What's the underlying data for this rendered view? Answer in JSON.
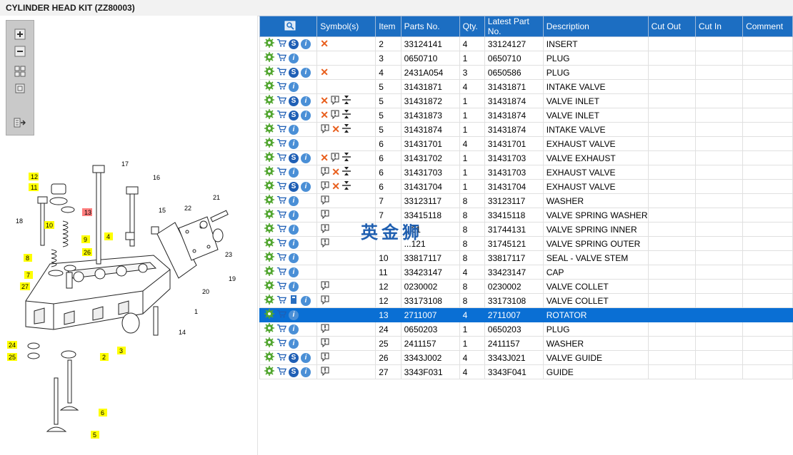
{
  "window": {
    "title": "CYLINDER HEAD KIT (ZZ80003)"
  },
  "toolbar": {
    "buttons": [
      "zoom-in",
      "zoom-out",
      "fit-all",
      "fit-window",
      "export"
    ]
  },
  "diagram": {
    "callouts": [
      "12",
      "11",
      "13",
      "18",
      "10",
      "9",
      "8",
      "26",
      "7",
      "27",
      "4",
      "15",
      "16",
      "17",
      "22",
      "21",
      "20",
      "19",
      "23",
      "1",
      "14",
      "3",
      "2",
      "24",
      "25",
      "6",
      "5"
    ]
  },
  "table": {
    "columns": [
      "",
      "Symbol(s)",
      "Item",
      "Parts No.",
      "Qty.",
      "Latest Part No.",
      "Description",
      "Cut Out",
      "Cut In",
      "Comment"
    ],
    "rows": [
      {
        "actions": [
          "settings",
          "cart",
          "s",
          "info"
        ],
        "symbols": [
          "cancel"
        ],
        "item": "2",
        "part": "33124141",
        "qty": "4",
        "latest": "33124127",
        "desc": "INSERT",
        "cut_out": "",
        "cut_in": "",
        "comment": ""
      },
      {
        "actions": [
          "settings",
          "cart",
          "info"
        ],
        "symbols": [],
        "item": "3",
        "part": "0650710",
        "qty": "1",
        "latest": "0650710",
        "desc": "PLUG",
        "cut_out": "",
        "cut_in": "",
        "comment": ""
      },
      {
        "actions": [
          "settings",
          "cart",
          "s",
          "info"
        ],
        "symbols": [
          "cancel"
        ],
        "item": "4",
        "part": "2431A054",
        "qty": "3",
        "latest": "0650586",
        "desc": "PLUG",
        "cut_out": "",
        "cut_in": "",
        "comment": ""
      },
      {
        "actions": [
          "settings",
          "cart",
          "info"
        ],
        "symbols": [],
        "item": "5",
        "part": "31431871",
        "qty": "4",
        "latest": "31431871",
        "desc": "INTAKE VALVE",
        "cut_out": "",
        "cut_in": "",
        "comment": ""
      },
      {
        "actions": [
          "settings",
          "cart",
          "s",
          "info"
        ],
        "symbols": [
          "cancel",
          "note",
          "swap"
        ],
        "item": "5",
        "part": "31431872",
        "qty": "1",
        "latest": "31431874",
        "desc": "VALVE INLET",
        "cut_out": "",
        "cut_in": "",
        "comment": ""
      },
      {
        "actions": [
          "settings",
          "cart",
          "s",
          "info"
        ],
        "symbols": [
          "cancel",
          "note",
          "swap"
        ],
        "item": "5",
        "part": "31431873",
        "qty": "1",
        "latest": "31431874",
        "desc": "VALVE INLET",
        "cut_out": "",
        "cut_in": "",
        "comment": ""
      },
      {
        "actions": [
          "settings",
          "cart",
          "info"
        ],
        "symbols": [
          "note",
          "cancel",
          "swap"
        ],
        "item": "5",
        "part": "31431874",
        "qty": "1",
        "latest": "31431874",
        "desc": "INTAKE VALVE",
        "cut_out": "",
        "cut_in": "",
        "comment": ""
      },
      {
        "actions": [
          "settings",
          "cart",
          "info"
        ],
        "symbols": [],
        "item": "6",
        "part": "31431701",
        "qty": "4",
        "latest": "31431701",
        "desc": "EXHAUST VALVE",
        "cut_out": "",
        "cut_in": "",
        "comment": ""
      },
      {
        "actions": [
          "settings",
          "cart",
          "s",
          "info"
        ],
        "symbols": [
          "cancel",
          "note",
          "swap"
        ],
        "item": "6",
        "part": "31431702",
        "qty": "1",
        "latest": "31431703",
        "desc": "VALVE EXHAUST",
        "cut_out": "",
        "cut_in": "",
        "comment": ""
      },
      {
        "actions": [
          "settings",
          "cart",
          "info"
        ],
        "symbols": [
          "note",
          "cancel",
          "swap"
        ],
        "item": "6",
        "part": "31431703",
        "qty": "1",
        "latest": "31431703",
        "desc": "EXHAUST VALVE",
        "cut_out": "",
        "cut_in": "",
        "comment": ""
      },
      {
        "actions": [
          "settings",
          "cart",
          "s",
          "info"
        ],
        "symbols": [
          "note",
          "cancel",
          "swap"
        ],
        "item": "6",
        "part": "31431704",
        "qty": "1",
        "latest": "31431704",
        "desc": "EXHAUST VALVE",
        "cut_out": "",
        "cut_in": "",
        "comment": ""
      },
      {
        "actions": [
          "settings",
          "cart",
          "info"
        ],
        "symbols": [
          "note"
        ],
        "item": "7",
        "part": "33123117",
        "qty": "8",
        "latest": "33123117",
        "desc": "WASHER",
        "cut_out": "",
        "cut_in": "",
        "comment": ""
      },
      {
        "actions": [
          "settings",
          "cart",
          "info"
        ],
        "symbols": [
          "note"
        ],
        "item": "7",
        "part": "33415118",
        "qty": "8",
        "latest": "33415118",
        "desc": "VALVE SPRING WASHER",
        "cut_out": "",
        "cut_in": "",
        "comment": ""
      },
      {
        "actions": [
          "settings",
          "cart",
          "info"
        ],
        "symbols": [
          "note"
        ],
        "item": "",
        "part": "...31",
        "qty": "8",
        "latest": "31744131",
        "desc": "VALVE SPRING INNER",
        "cut_out": "",
        "cut_in": "",
        "comment": ""
      },
      {
        "actions": [
          "settings",
          "cart",
          "info"
        ],
        "symbols": [
          "note"
        ],
        "item": "",
        "part": "...121",
        "qty": "8",
        "latest": "31745121",
        "desc": "VALVE SPRING OUTER",
        "cut_out": "",
        "cut_in": "",
        "comment": ""
      },
      {
        "actions": [
          "settings",
          "cart",
          "info"
        ],
        "symbols": [],
        "item": "10",
        "part": "33817117",
        "qty": "8",
        "latest": "33817117",
        "desc": "SEAL - VALVE STEM",
        "cut_out": "",
        "cut_in": "",
        "comment": ""
      },
      {
        "actions": [
          "settings",
          "cart",
          "info"
        ],
        "symbols": [],
        "item": "11",
        "part": "33423147",
        "qty": "4",
        "latest": "33423147",
        "desc": "CAP",
        "cut_out": "",
        "cut_in": "",
        "comment": ""
      },
      {
        "actions": [
          "settings",
          "cart",
          "info"
        ],
        "symbols": [
          "note"
        ],
        "item": "12",
        "part": "0230002",
        "qty": "8",
        "latest": "0230002",
        "desc": "VALVE COLLET",
        "cut_out": "",
        "cut_in": "",
        "comment": ""
      },
      {
        "actions": [
          "settings",
          "cart",
          "book",
          "info"
        ],
        "symbols": [
          "note"
        ],
        "item": "12",
        "part": "33173108",
        "qty": "8",
        "latest": "33173108",
        "desc": "VALVE COLLET",
        "cut_out": "",
        "cut_in": "",
        "comment": ""
      },
      {
        "actions": [
          "settings",
          "cart",
          "info"
        ],
        "symbols": [],
        "item": "13",
        "part": "2711007",
        "qty": "4",
        "latest": "2711007",
        "desc": "ROTATOR",
        "cut_out": "",
        "cut_in": "",
        "comment": "",
        "selected": true
      },
      {
        "actions": [
          "settings",
          "cart",
          "info"
        ],
        "symbols": [
          "note"
        ],
        "item": "24",
        "part": "0650203",
        "qty": "1",
        "latest": "0650203",
        "desc": "PLUG",
        "cut_out": "",
        "cut_in": "",
        "comment": ""
      },
      {
        "actions": [
          "settings",
          "cart",
          "info"
        ],
        "symbols": [
          "note"
        ],
        "item": "25",
        "part": "2411157",
        "qty": "1",
        "latest": "2411157",
        "desc": "WASHER",
        "cut_out": "",
        "cut_in": "",
        "comment": ""
      },
      {
        "actions": [
          "settings",
          "cart",
          "s",
          "info"
        ],
        "symbols": [
          "note"
        ],
        "item": "26",
        "part": "3343J002",
        "qty": "4",
        "latest": "3343J021",
        "desc": "VALVE GUIDE",
        "cut_out": "",
        "cut_in": "",
        "comment": ""
      },
      {
        "actions": [
          "settings",
          "cart",
          "s",
          "info"
        ],
        "symbols": [
          "note"
        ],
        "item": "27",
        "part": "3343F031",
        "qty": "4",
        "latest": "3343F041",
        "desc": "GUIDE",
        "cut_out": "",
        "cut_in": "",
        "comment": ""
      }
    ]
  },
  "watermark": "英金狮"
}
